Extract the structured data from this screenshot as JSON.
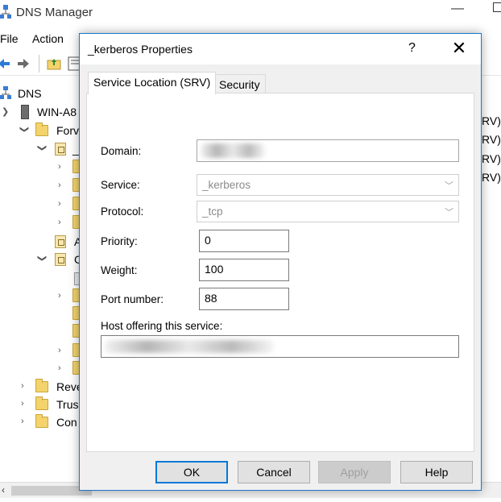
{
  "app": {
    "title": "DNS Manager",
    "menu": [
      "File",
      "Action"
    ]
  },
  "tree": {
    "root": "DNS",
    "server": "WIN-A8",
    "forward": "Forv",
    "fwd_child_a": "_",
    "zone_item_a": "A",
    "zone_item_c": "C",
    "reverse": "Reve",
    "trust": "Trus",
    "conditional": "Con"
  },
  "right_pane": [
    "RV)",
    "RV)",
    "RV)",
    "RV)"
  ],
  "dialog": {
    "title": "_kerberos Properties",
    "help": "?",
    "close": "✕",
    "tabs": [
      "Service Location (SRV)",
      "Security"
    ],
    "domain_label": "Domain:",
    "service_label": "Service:",
    "service_value": "_kerberos",
    "protocol_label": "Protocol:",
    "protocol_value": "_tcp",
    "priority_label": "Priority:",
    "priority_value": "0",
    "weight_label": "Weight:",
    "weight_value": "100",
    "port_label": "Port number:",
    "port_value": "88",
    "host_label": "Host offering this service:",
    "buttons": {
      "ok": "OK",
      "cancel": "Cancel",
      "apply": "Apply",
      "help": "Help"
    }
  },
  "colors": {
    "accent": "#0078d7",
    "dialog_border": "#1979ca",
    "folder": "#f4d36c"
  }
}
